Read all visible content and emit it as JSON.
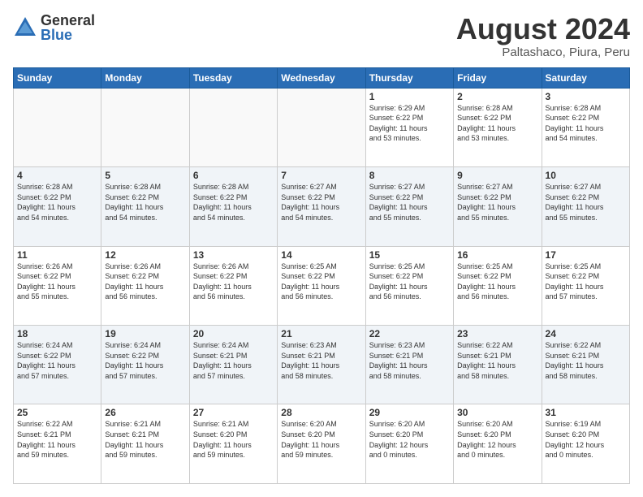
{
  "logo": {
    "general": "General",
    "blue": "Blue"
  },
  "header": {
    "month_year": "August 2024",
    "location": "Paltashaco, Piura, Peru"
  },
  "weekdays": [
    "Sunday",
    "Monday",
    "Tuesday",
    "Wednesday",
    "Thursday",
    "Friday",
    "Saturday"
  ],
  "weeks": [
    [
      {
        "day": "",
        "info": "",
        "empty": true
      },
      {
        "day": "",
        "info": "",
        "empty": true
      },
      {
        "day": "",
        "info": "",
        "empty": true
      },
      {
        "day": "",
        "info": "",
        "empty": true
      },
      {
        "day": "1",
        "info": "Sunrise: 6:29 AM\nSunset: 6:22 PM\nDaylight: 11 hours\nand 53 minutes."
      },
      {
        "day": "2",
        "info": "Sunrise: 6:28 AM\nSunset: 6:22 PM\nDaylight: 11 hours\nand 53 minutes."
      },
      {
        "day": "3",
        "info": "Sunrise: 6:28 AM\nSunset: 6:22 PM\nDaylight: 11 hours\nand 54 minutes."
      }
    ],
    [
      {
        "day": "4",
        "info": "Sunrise: 6:28 AM\nSunset: 6:22 PM\nDaylight: 11 hours\nand 54 minutes."
      },
      {
        "day": "5",
        "info": "Sunrise: 6:28 AM\nSunset: 6:22 PM\nDaylight: 11 hours\nand 54 minutes."
      },
      {
        "day": "6",
        "info": "Sunrise: 6:28 AM\nSunset: 6:22 PM\nDaylight: 11 hours\nand 54 minutes."
      },
      {
        "day": "7",
        "info": "Sunrise: 6:27 AM\nSunset: 6:22 PM\nDaylight: 11 hours\nand 54 minutes."
      },
      {
        "day": "8",
        "info": "Sunrise: 6:27 AM\nSunset: 6:22 PM\nDaylight: 11 hours\nand 55 minutes."
      },
      {
        "day": "9",
        "info": "Sunrise: 6:27 AM\nSunset: 6:22 PM\nDaylight: 11 hours\nand 55 minutes."
      },
      {
        "day": "10",
        "info": "Sunrise: 6:27 AM\nSunset: 6:22 PM\nDaylight: 11 hours\nand 55 minutes."
      }
    ],
    [
      {
        "day": "11",
        "info": "Sunrise: 6:26 AM\nSunset: 6:22 PM\nDaylight: 11 hours\nand 55 minutes."
      },
      {
        "day": "12",
        "info": "Sunrise: 6:26 AM\nSunset: 6:22 PM\nDaylight: 11 hours\nand 56 minutes."
      },
      {
        "day": "13",
        "info": "Sunrise: 6:26 AM\nSunset: 6:22 PM\nDaylight: 11 hours\nand 56 minutes."
      },
      {
        "day": "14",
        "info": "Sunrise: 6:25 AM\nSunset: 6:22 PM\nDaylight: 11 hours\nand 56 minutes."
      },
      {
        "day": "15",
        "info": "Sunrise: 6:25 AM\nSunset: 6:22 PM\nDaylight: 11 hours\nand 56 minutes."
      },
      {
        "day": "16",
        "info": "Sunrise: 6:25 AM\nSunset: 6:22 PM\nDaylight: 11 hours\nand 56 minutes."
      },
      {
        "day": "17",
        "info": "Sunrise: 6:25 AM\nSunset: 6:22 PM\nDaylight: 11 hours\nand 57 minutes."
      }
    ],
    [
      {
        "day": "18",
        "info": "Sunrise: 6:24 AM\nSunset: 6:22 PM\nDaylight: 11 hours\nand 57 minutes."
      },
      {
        "day": "19",
        "info": "Sunrise: 6:24 AM\nSunset: 6:22 PM\nDaylight: 11 hours\nand 57 minutes."
      },
      {
        "day": "20",
        "info": "Sunrise: 6:24 AM\nSunset: 6:21 PM\nDaylight: 11 hours\nand 57 minutes."
      },
      {
        "day": "21",
        "info": "Sunrise: 6:23 AM\nSunset: 6:21 PM\nDaylight: 11 hours\nand 58 minutes."
      },
      {
        "day": "22",
        "info": "Sunrise: 6:23 AM\nSunset: 6:21 PM\nDaylight: 11 hours\nand 58 minutes."
      },
      {
        "day": "23",
        "info": "Sunrise: 6:22 AM\nSunset: 6:21 PM\nDaylight: 11 hours\nand 58 minutes."
      },
      {
        "day": "24",
        "info": "Sunrise: 6:22 AM\nSunset: 6:21 PM\nDaylight: 11 hours\nand 58 minutes."
      }
    ],
    [
      {
        "day": "25",
        "info": "Sunrise: 6:22 AM\nSunset: 6:21 PM\nDaylight: 11 hours\nand 59 minutes."
      },
      {
        "day": "26",
        "info": "Sunrise: 6:21 AM\nSunset: 6:21 PM\nDaylight: 11 hours\nand 59 minutes."
      },
      {
        "day": "27",
        "info": "Sunrise: 6:21 AM\nSunset: 6:20 PM\nDaylight: 11 hours\nand 59 minutes."
      },
      {
        "day": "28",
        "info": "Sunrise: 6:20 AM\nSunset: 6:20 PM\nDaylight: 11 hours\nand 59 minutes."
      },
      {
        "day": "29",
        "info": "Sunrise: 6:20 AM\nSunset: 6:20 PM\nDaylight: 12 hours\nand 0 minutes."
      },
      {
        "day": "30",
        "info": "Sunrise: 6:20 AM\nSunset: 6:20 PM\nDaylight: 12 hours\nand 0 minutes."
      },
      {
        "day": "31",
        "info": "Sunrise: 6:19 AM\nSunset: 6:20 PM\nDaylight: 12 hours\nand 0 minutes."
      }
    ]
  ]
}
